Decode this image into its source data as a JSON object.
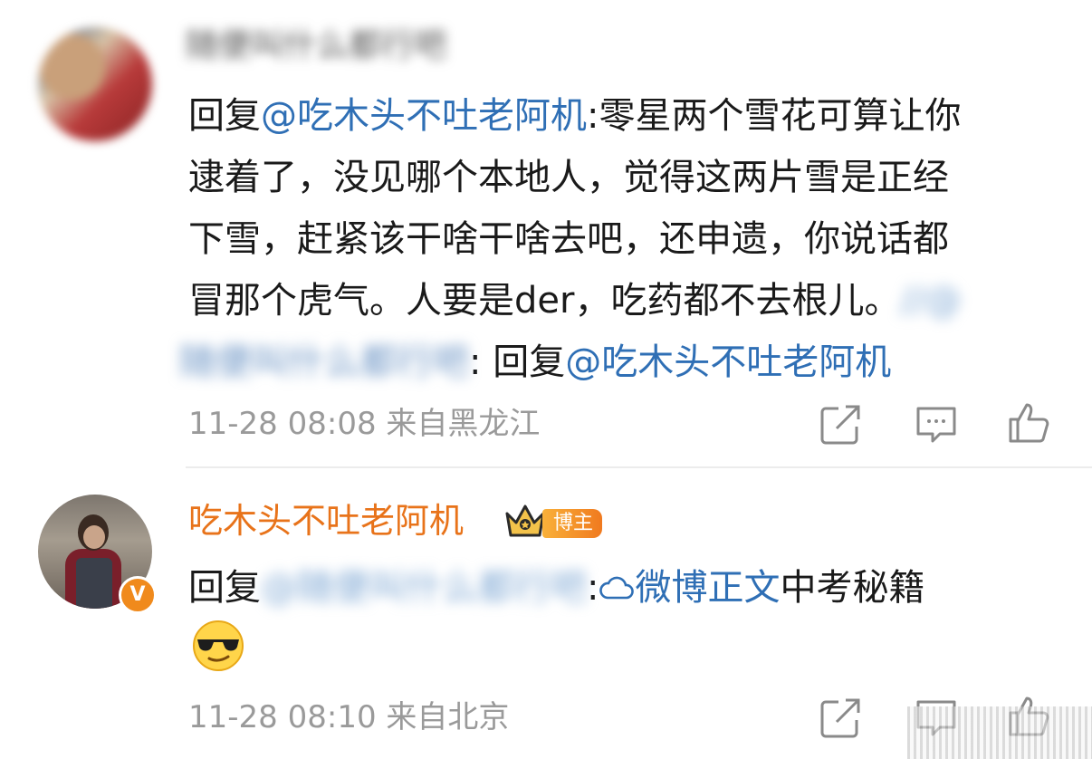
{
  "comment1": {
    "username_blurred": "随便叫什么都行吧",
    "reply_prefix": "回复",
    "reply_mention": "@吃木头不吐老阿机",
    "text_line1_tail": ":零星两个雪花可算让你",
    "text_line2": "逮着了，没见哪个本地人，觉得这两片雪是正经",
    "text_line3": "下雪，赶紧该干啥干啥去吧，还申遗，你说话都",
    "text_line4": "冒那个虎气。人要是der，吃药都不去根儿。",
    "text_line4_blur": "//@",
    "quote_blurred_name": "随便叫什么都行吧",
    "quote_sep": ":",
    "quote_reply": "回复",
    "quote_mention": "@吃木头不吐老阿机",
    "timestamp": "11-28 08:08",
    "location": "来自黑龙江"
  },
  "comment2": {
    "author": "吃木头不吐老阿机",
    "badge": "博主",
    "reply_prefix": "回复",
    "reply_mention_blurred": "@随便叫什么都行吧",
    "sep": ":",
    "link_text": "微博正文",
    "text_tail": "中考秘籍",
    "emoji": "cool-sunglasses-emoji",
    "timestamp": "11-28 08:10",
    "location": "来自北京"
  },
  "colors": {
    "link": "#2f6fb5",
    "author": "#e8731a",
    "meta": "#9a9a9a",
    "text": "#1a1a1a"
  },
  "verified_badge": "V"
}
